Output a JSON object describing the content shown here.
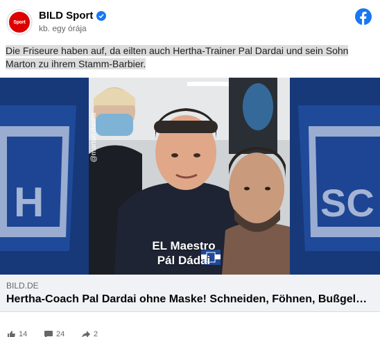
{
  "post": {
    "page_name": "BILD Sport",
    "avatar_text": "Sport",
    "timestamp": "kb. egy órája",
    "caption": "Die Friseure haben auf, da eilten auch Hertha-Trainer Pal Dardai und sein Sohn Marton zu ihrem Stamm-Barbier."
  },
  "media": {
    "overlay_line1": "EL Maestro",
    "overlay_line2": "Pál Dádai",
    "handle": "@marton.dardai"
  },
  "link": {
    "domain": "BILD.DE",
    "title": "Hertha-Coach Pal Dardai ohne Maske! Schneiden, Föhnen, Bußgel…"
  },
  "stats": {
    "likes": "14",
    "comments": "24",
    "shares": "2"
  },
  "colors": {
    "brand_blue": "#1877f2",
    "bild_red": "#dd0000",
    "hertha_blue": "#1f4a9a"
  }
}
